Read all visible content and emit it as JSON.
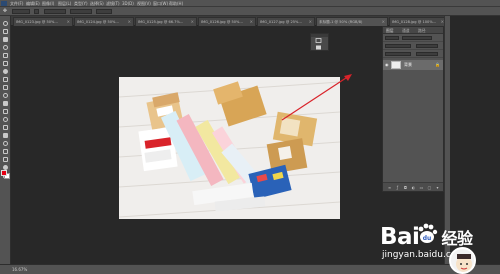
{
  "menubar": {
    "items": [
      "文件(F)",
      "编辑(E)",
      "图像(I)",
      "图层(L)",
      "类型(Y)",
      "选择(S)",
      "滤镜(T)",
      "3D(D)",
      "视图(V)",
      "窗口(W)",
      "帮助(H)"
    ]
  },
  "tabs": [
    {
      "label": "IMG_0123.jpg @ 50%...",
      "active": false
    },
    {
      "label": "IMG_0124.jpg @ 50%...",
      "active": false
    },
    {
      "label": "IMG_0125.jpg @ 66.7%...",
      "active": false
    },
    {
      "label": "IMG_0126.jpg @ 50%...",
      "active": false
    },
    {
      "label": "IMG_0127.jpg @ 25%...",
      "active": false
    },
    {
      "label": "未标题-1 @ 50% (RGB/8)",
      "active": true
    },
    {
      "label": "IMG_0128.jpg @ 100%...",
      "active": false
    }
  ],
  "layers_panel": {
    "tabs": [
      "图层",
      "通道",
      "路径"
    ],
    "layer_name": "背景",
    "lock_icon": "lock-icon",
    "eye_icon": "eye-icon"
  },
  "status": {
    "zoom": "16.67%"
  },
  "watermark": {
    "brand": "Bai",
    "brand_tail": "经验",
    "url": "jingyan.baidu.com"
  },
  "colors": {
    "foreground": "#e50013",
    "background": "#ffffff",
    "ui_panel": "#535353",
    "canvas_bg": "#282828",
    "arrow": "#d9232a"
  }
}
